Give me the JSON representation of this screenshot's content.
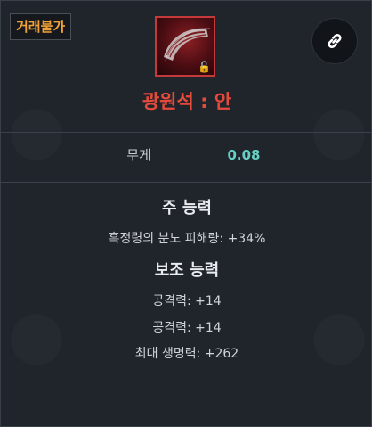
{
  "badge": {
    "trade_label": "거래불가"
  },
  "item": {
    "name": "광원석 : 안",
    "frame_color": "#c43a3a",
    "name_color": "#e64a3b",
    "icon": "orb-stone-fragment-icon",
    "lock_icon": "unlock-icon"
  },
  "actions": {
    "link_icon": "link-icon"
  },
  "weight": {
    "label": "무게",
    "value": "0.08"
  },
  "main_ability": {
    "title": "주 능력",
    "lines": [
      "흑정령의 분노 피해량: +34%"
    ]
  },
  "sub_ability": {
    "title": "보조 능력",
    "lines": [
      "공격력: +14",
      "공격력: +14",
      "최대 생명력: +262"
    ]
  },
  "colors": {
    "badge_text": "#f0a236",
    "weight_value": "#67d0c6"
  }
}
